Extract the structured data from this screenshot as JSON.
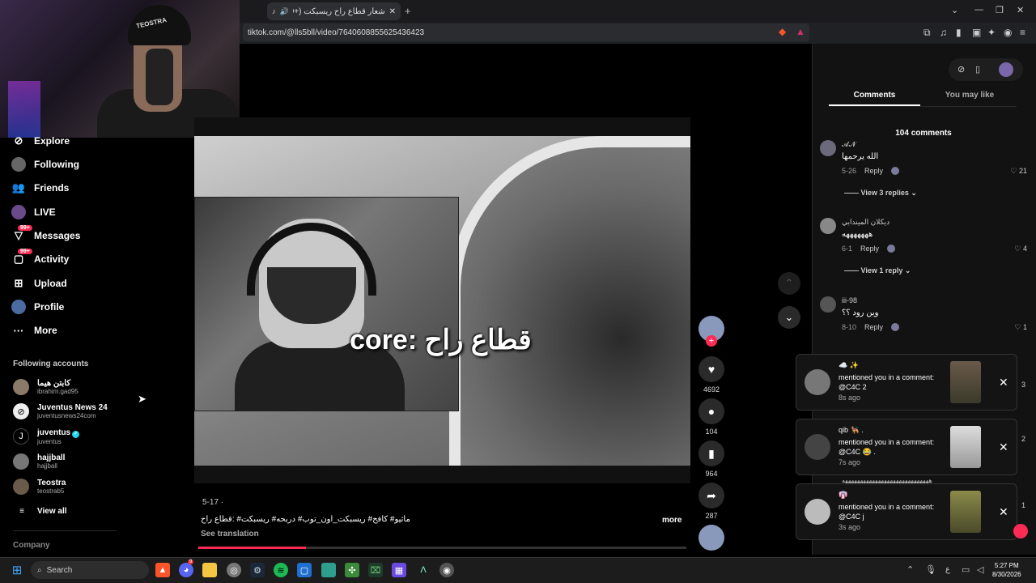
{
  "browser": {
    "tab_title": "شعار قطاع راح ريسبكت (+99) --",
    "url": "tiktok.com/@lls5bll/video/7640608855625436423"
  },
  "sidebar": {
    "nav": [
      {
        "label": "Explore",
        "icon": "compass-icon"
      },
      {
        "label": "Following",
        "icon": "avatar-icon"
      },
      {
        "label": "Friends",
        "icon": "friends-icon"
      },
      {
        "label": "LIVE",
        "icon": "live-icon"
      },
      {
        "label": "Messages",
        "icon": "messages-icon",
        "badge": "99+"
      },
      {
        "label": "Activity",
        "icon": "activity-icon",
        "badge": "99+"
      },
      {
        "label": "Upload",
        "icon": "upload-icon"
      },
      {
        "label": "Profile",
        "icon": "profile-icon"
      },
      {
        "label": "More",
        "icon": "more-icon"
      }
    ],
    "following_heading": "Following accounts",
    "accounts": [
      {
        "name": "كابتن هيما",
        "handle": "ibrahim.gad95"
      },
      {
        "name": "Juventus News 24",
        "handle": "juventusnews24com"
      },
      {
        "name": "juventus",
        "handle": "juventus",
        "verified": true
      },
      {
        "name": "hajjball",
        "handle": "hajjball"
      },
      {
        "name": "Teostra",
        "handle": "teostrab5"
      }
    ],
    "view_all": "View all",
    "company": "Company"
  },
  "video": {
    "overlay_text": "قطاع راح :core",
    "date": "5-17 ·",
    "description": "ماثيو# كافح# ريسبكت_اون_توب# دربحه# ريسبكت# :قطاع راح",
    "more": "more",
    "see_translation": "See translation",
    "progress": 0.22
  },
  "actions": {
    "likes": "4692",
    "comments": "104",
    "saves": "964",
    "shares": "287"
  },
  "panel": {
    "tab_comments": "Comments",
    "tab_you_may_like": "You may like",
    "comment_count": "104 comments",
    "comments": [
      {
        "user": "𝓐𝓝",
        "text": "الله يرحمها",
        "date": "5-26",
        "reply": "Reply",
        "likes": "21",
        "view_replies": "View 3 replies"
      },
      {
        "user": "ديكلان الميندابي",
        "text": "هههههههه",
        "date": "6-1",
        "reply": "Reply",
        "likes": "4",
        "view_replies": "View 1 reply"
      },
      {
        "user": "iii-98",
        "text": "وين رود ؟؟",
        "date": "8-10",
        "reply": "Reply",
        "likes": "1"
      }
    ],
    "side_counts": [
      "3",
      "2",
      "1"
    ],
    "hidden_text": "هههههههههههههههههههههههههههههه"
  },
  "notifications": [
    {
      "user": "☁️ ✨",
      "text": "mentioned you in a comment: @C4C 2",
      "time": "8s ago"
    },
    {
      "user": "qib 🐕‍🦺 .",
      "text": "mentioned you in a comment: @C4C 😂 .",
      "time": "7s ago"
    },
    {
      "user": "👘",
      "text": "mentioned you in a comment: @C4C j",
      "time": "3s ago"
    }
  ],
  "taskbar": {
    "search": "Search",
    "time": "5:27 PM",
    "date": "8/30/2026",
    "lang": "ع",
    "discord_badge": "9"
  },
  "webcam": {
    "cap_text": "TEOSTRA"
  }
}
